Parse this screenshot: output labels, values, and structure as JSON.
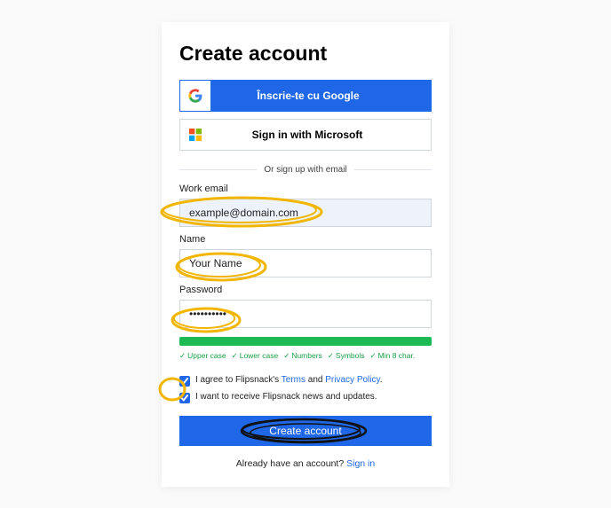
{
  "title": "Create account",
  "google_label": "Înscrie-te cu Google",
  "microsoft_label": "Sign in with Microsoft",
  "divider": "Or sign up with email",
  "email": {
    "label": "Work email",
    "value": "example@domain.com"
  },
  "name": {
    "label": "Name",
    "value": "Your Name"
  },
  "password": {
    "label": "Password",
    "value": "••••••••••"
  },
  "reqs": {
    "upper": "Upper case",
    "lower": "Lower case",
    "numbers": "Numbers",
    "symbols": "Symbols",
    "min8": "Min 8 char."
  },
  "terms": {
    "prefix": "I agree to Flipsnack's ",
    "link1": "Terms",
    "mid": " and ",
    "link2": "Privacy Policy",
    "suffix": "."
  },
  "news": "I want to receive Flipsnack news and updates.",
  "create_btn": "Create account",
  "signin": {
    "text": "Already have an account? ",
    "link": "Sign in"
  }
}
